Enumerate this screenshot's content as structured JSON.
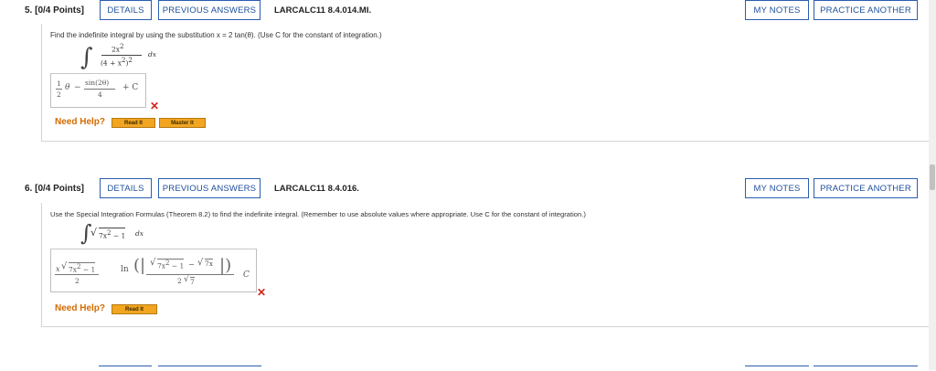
{
  "q5": {
    "number": "5.  [0/4 Points]",
    "details": "DETAILS",
    "previous": "PREVIOUS ANSWERS",
    "code": "LARCALC11 8.4.014.MI.",
    "my_notes": "MY NOTES",
    "practice": "PRACTICE ANOTHER",
    "prompt": "Find the indefinite integral by using the substitution x = 2 tan(θ). (Use C for the constant of integration.)",
    "integral": {
      "num": "2x",
      "num_exp": "2",
      "den": "(4 + x",
      "den_exp": "2",
      "den_close": ")",
      "den_outer_exp": "2",
      "dx": "dx"
    },
    "answer": {
      "frac1_num": "1",
      "frac1_den": "2",
      "theta": "θ",
      "minus": "−",
      "frac2_num": "sin(2θ)",
      "frac2_den": "4",
      "plus_c": "+ C"
    },
    "need_help": "Need Help?",
    "read_it": "Read It",
    "master_it": "Master It"
  },
  "q6": {
    "number": "6.  [0/4 Points]",
    "details": "DETAILS",
    "previous": "PREVIOUS ANSWERS",
    "code": "LARCALC11 8.4.016.",
    "my_notes": "MY NOTES",
    "practice": "PRACTICE ANOTHER",
    "prompt": "Use the Special Integration Formulas (Theorem 8.2) to find the indefinite integral. (Remember to use absolute values where appropriate. Use C for the constant of integration.)",
    "integral": {
      "radicand": "7x",
      "exp": "2",
      "tail": " − 1",
      "dx": "dx"
    },
    "answer": {
      "t1_num_a": "x",
      "t1_rad": "7x",
      "t1_exp": "2",
      "t1_tail": " − 1",
      "t1_den": "2",
      "ln": "ln",
      "t2_rad": "7x",
      "t2_exp": "2",
      "t2_tail": " − 1",
      "minus": " − ",
      "t2_rad2": "7x",
      "t2_den": "2",
      "t2_den_rad": "7",
      "c": "C"
    },
    "need_help": "Need Help?",
    "read_it": "Read It"
  },
  "colors": {
    "link_blue": "#1e4f9e",
    "help_orange": "#f1a520",
    "wrong_red": "#d0261b",
    "need_help_text": "#d36b00"
  }
}
